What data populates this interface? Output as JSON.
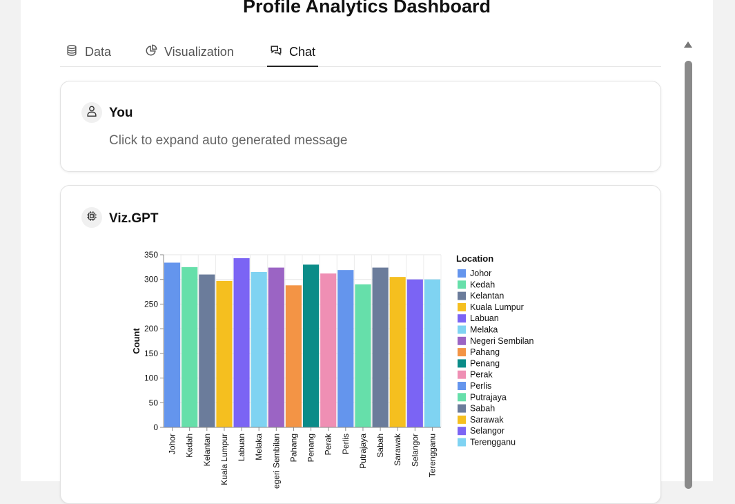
{
  "page": {
    "title": "Profile Analytics Dashboard"
  },
  "tabs": [
    {
      "label": "Data",
      "icon": "database-icon"
    },
    {
      "label": "Visualization",
      "icon": "pie-chart-icon"
    },
    {
      "label": "Chat",
      "icon": "chat-bubbles-icon",
      "active": true
    }
  ],
  "messages": [
    {
      "sender": "You",
      "text": "Click to expand auto generated message",
      "icon": "user-icon"
    },
    {
      "sender": "Viz.GPT",
      "icon": "cpu-chip-icon"
    }
  ],
  "chart_data": {
    "type": "bar",
    "categories": [
      "Johor",
      "Kedah",
      "Kelantan",
      "Kuala Lumpur",
      "Labuan",
      "Melaka",
      "Negeri Sembilan",
      "Pahang",
      "Penang",
      "Perak",
      "Perlis",
      "Putrajaya",
      "Sabah",
      "Sarawak",
      "Selangor",
      "Terengganu"
    ],
    "values": [
      334,
      325,
      310,
      297,
      343,
      315,
      324,
      288,
      330,
      312,
      319,
      290,
      324,
      305,
      300,
      300
    ],
    "colors": [
      "#6495ed",
      "#66dfaa",
      "#6b7c9b",
      "#f5bf1f",
      "#7b64f4",
      "#7fd3f2",
      "#9b64c4",
      "#f39445",
      "#0b8c88",
      "#ef8fb4",
      "#6495ed",
      "#66dfaa",
      "#6b7c9b",
      "#f5bf1f",
      "#7b64f4",
      "#7fd3f2"
    ],
    "ylabel": "Count",
    "xlabel": "",
    "ylim": [
      0,
      350
    ],
    "yticks": [
      0,
      50,
      100,
      150,
      200,
      250,
      300,
      350
    ],
    "legend_title": "Location",
    "legend_position": "right",
    "grid": true
  }
}
